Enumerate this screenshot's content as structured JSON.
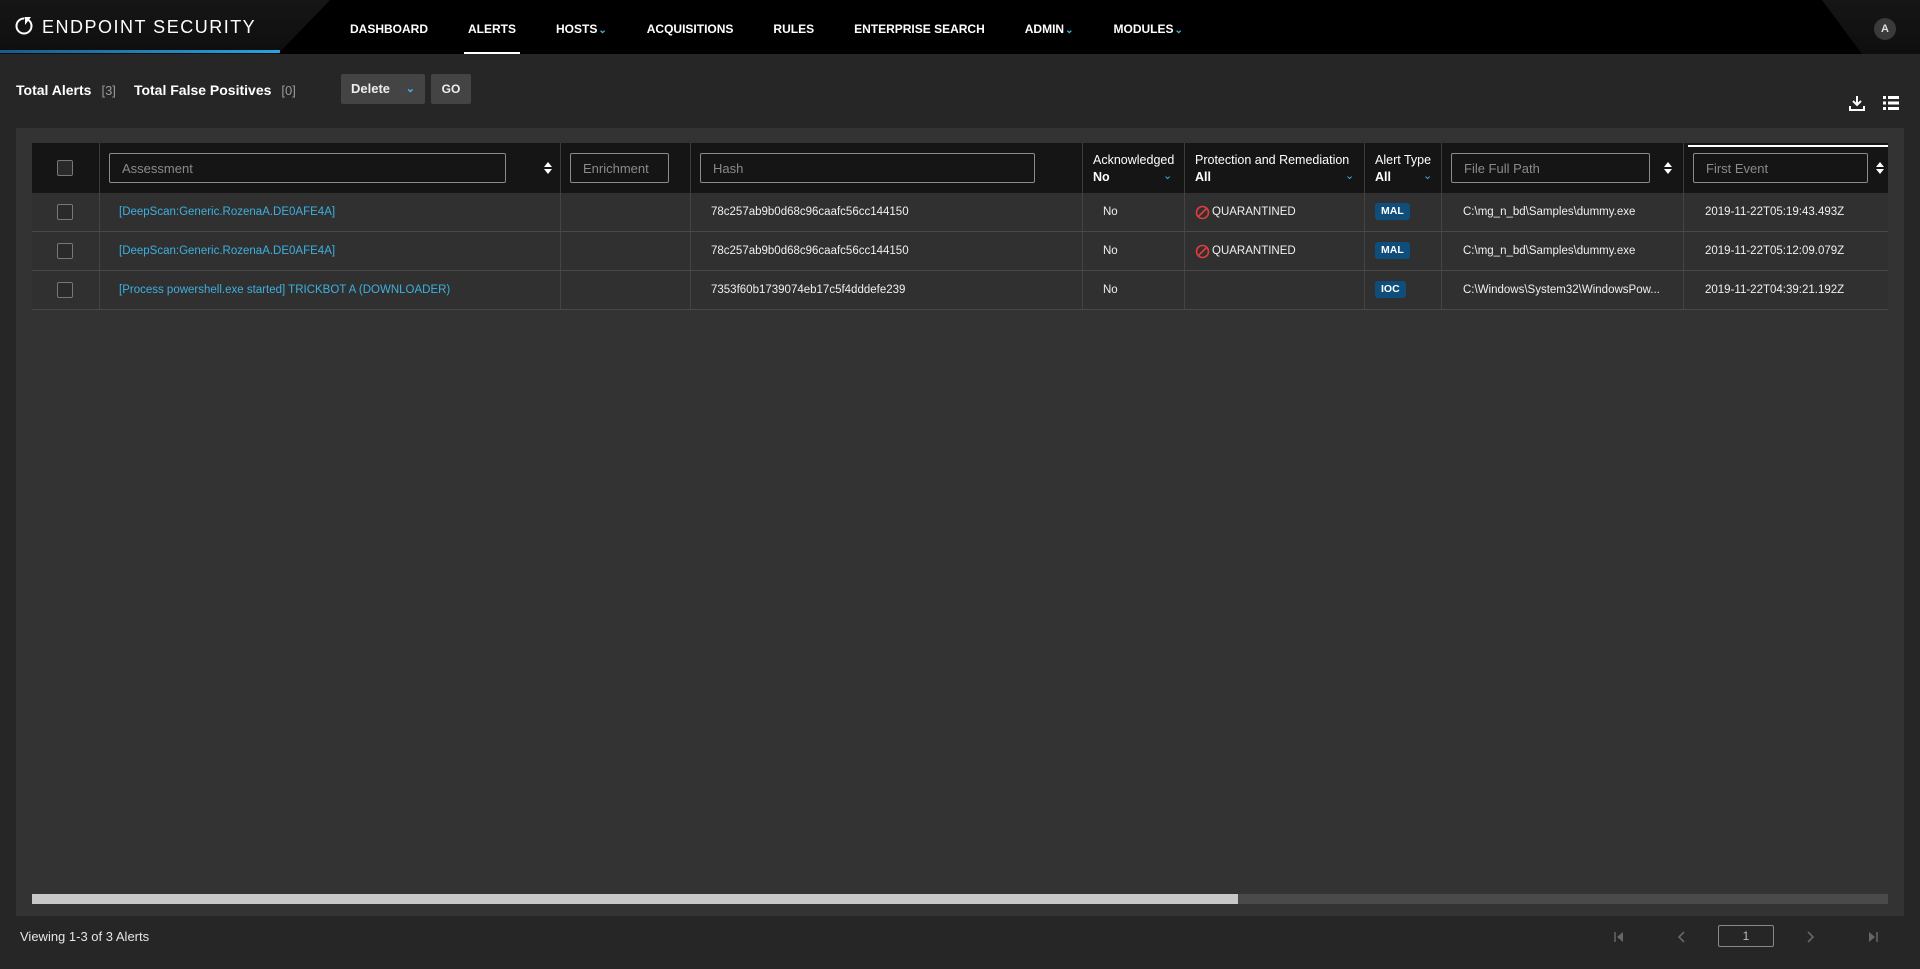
{
  "app": {
    "brand": "ENDPOINT SECURITY",
    "user_initial": "A"
  },
  "nav": [
    {
      "label": "DASHBOARD",
      "dropdown": false
    },
    {
      "label": "ALERTS",
      "dropdown": false,
      "active": true
    },
    {
      "label": "HOSTS",
      "dropdown": true
    },
    {
      "label": "ACQUISITIONS",
      "dropdown": false
    },
    {
      "label": "RULES",
      "dropdown": false
    },
    {
      "label": "ENTERPRISE SEARCH",
      "dropdown": false
    },
    {
      "label": "ADMIN",
      "dropdown": true
    },
    {
      "label": "MODULES",
      "dropdown": true
    }
  ],
  "summary": {
    "total_alerts_label": "Total Alerts",
    "total_alerts_count": "[3]",
    "false_positives_label": "Total False Positives",
    "false_positives_count": "[0]",
    "action_selected": "Delete",
    "go_label": "GO"
  },
  "columns": {
    "assessment_placeholder": "Assessment",
    "enrichment_placeholder": "Enrichment",
    "hash_placeholder": "Hash",
    "acknowledged_title": "Acknowledged",
    "acknowledged_value": "No",
    "protection_title": "Protection and Remediation",
    "protection_value": "All",
    "alert_type_title": "Alert Type",
    "alert_type_value": "All",
    "file_path_placeholder": "File Full Path",
    "first_event_placeholder": "First Event"
  },
  "rows": [
    {
      "assessment": "[DeepScan:Generic.RozenaA.DE0AFE4A]",
      "enrichment": "",
      "hash": "78c257ab9b0d68c96caafc56cc144150",
      "acknowledged": "No",
      "protection": "QUARANTINED",
      "alert_type": "MAL",
      "file_path": "C:\\mg_n_bd\\Samples\\dummy.exe",
      "first_event": "2019-11-22T05:19:43.493Z"
    },
    {
      "assessment": "[DeepScan:Generic.RozenaA.DE0AFE4A]",
      "enrichment": "",
      "hash": "78c257ab9b0d68c96caafc56cc144150",
      "acknowledged": "No",
      "protection": "QUARANTINED",
      "alert_type": "MAL",
      "file_path": "C:\\mg_n_bd\\Samples\\dummy.exe",
      "first_event": "2019-11-22T05:12:09.079Z"
    },
    {
      "assessment": "[Process powershell.exe started] TRICKBOT A (DOWNLOADER)",
      "enrichment": "",
      "hash": "7353f60b1739074eb17c5f4dddefe239",
      "acknowledged": "No",
      "protection": "",
      "alert_type": "IOC",
      "file_path": "C:\\Windows\\System32\\WindowsPow...",
      "first_event": "2019-11-22T04:39:21.192Z"
    }
  ],
  "scroll": {
    "horizontal_position_fraction": 0.0,
    "visible_fraction": 0.65
  },
  "footer": {
    "viewing_text": "Viewing 1-3 of 3 Alerts",
    "page_value": "1"
  },
  "colors": {
    "accent": "#3db5e6",
    "link": "#3db0e0",
    "badge": "#0f4e7a",
    "quarantine": "#e03c3c"
  }
}
